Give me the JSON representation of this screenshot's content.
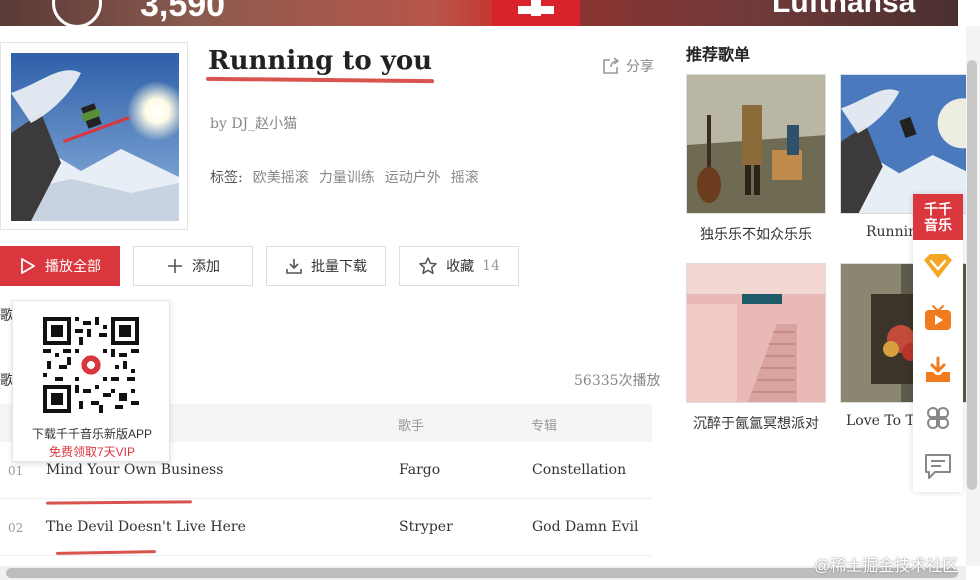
{
  "banner": {
    "number": "3,590",
    "brand": "Lufthansa"
  },
  "playlist": {
    "title": "Running to you",
    "author": "by DJ_赵小猫",
    "share_label": "分享",
    "tags_label": "标签:",
    "tags": [
      "欧美摇滚",
      "力量训练",
      "运动户外",
      "摇滚"
    ]
  },
  "actions": {
    "play_all": "播放全部",
    "add": "添加",
    "batch_download": "批量下载",
    "favorite": "收藏",
    "favorite_count": "14"
  },
  "left_edge": {
    "a": "歌",
    "b": "歌"
  },
  "play_count": "56335次播放",
  "qr_popup": {
    "line1": "下载千千音乐新版APP",
    "line2": "免费领取7天VIP"
  },
  "table": {
    "headers": {
      "artist": "歌手",
      "album": "专辑"
    },
    "rows": [
      {
        "index": "01",
        "name": "Mind Your Own Business",
        "artist": "Fargo",
        "album": "Constellation"
      },
      {
        "index": "02",
        "name": "The Devil Doesn't Live Here",
        "artist": "Stryper",
        "album": "God Damn Evil"
      }
    ]
  },
  "recommend": {
    "title": "推荐歌单",
    "items": [
      {
        "caption": "独乐乐不如众乐乐"
      },
      {
        "caption": "Running"
      },
      {
        "caption": "沉醉于氤氲冥想派对"
      },
      {
        "caption": "Love To Try"
      }
    ]
  },
  "float_bar": {
    "logo_line1": "千千",
    "logo_line2": "音乐"
  },
  "watermark": "@稀土掘金技术社区",
  "colors": {
    "accent": "#d9363e"
  }
}
